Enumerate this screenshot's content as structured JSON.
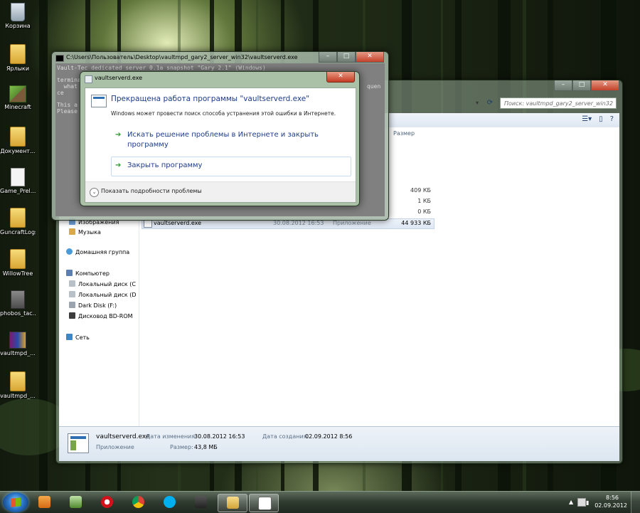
{
  "desktop": {
    "icons": [
      {
        "label": "Корзина",
        "icon": "recycle-bin-icon"
      },
      {
        "label": "Ярлыки",
        "icon": "folder-icon"
      },
      {
        "label": "Minecraft",
        "icon": "minecraft-icon"
      },
      {
        "label": "Документ...",
        "icon": "folder-icon"
      },
      {
        "label": "Game_Prel...",
        "icon": "document-icon"
      },
      {
        "label": "GuncraftLogs",
        "icon": "folder-icon"
      },
      {
        "label": "WillowTree",
        "icon": "folder-icon"
      },
      {
        "label": "phobos_tac...",
        "icon": "document-icon"
      },
      {
        "label": "vaultmpd_...",
        "icon": "winrar-archive-icon"
      },
      {
        "label": "vaultmpd_...",
        "icon": "folder-icon"
      }
    ]
  },
  "explorer": {
    "search_placeholder": "Поиск: vaultmpd_gary2_server_win32",
    "column_size_header": "Размер",
    "sizes": [
      "409 КБ",
      "1 КБ",
      "0 КБ",
      "44 933 КБ"
    ],
    "nav": {
      "images": "Изображения",
      "music": "Музыка",
      "homegroup": "Домашняя группа",
      "computer": "Компьютер",
      "local_c": "Локальный диск (C",
      "local_d": "Локальный диск (D",
      "dark_disk": "Dark Disk (F:)",
      "bdrom": "Дисковод BD-ROM",
      "network": "Сеть"
    },
    "selected_file": {
      "name": "vaultserverd.exe",
      "date": "30.08.2012 16:53",
      "type": "Приложение",
      "size": "44 933 КБ"
    },
    "details": {
      "name": "vaultserverd.exe",
      "type": "Приложение",
      "modified_label": "Дата изменения:",
      "modified_value": "30.08.2012 16:53",
      "created_label": "Дата создания:",
      "created_value": "02.09.2012 8:56",
      "size_label": "Размер:",
      "size_value": "43,8 МБ"
    }
  },
  "console": {
    "title": "C:\\Users\\Пользователь\\Desktop\\vaultmpd_gary2_server_win32\\vaultserverd.exe",
    "lines": [
      "Vault-Tec dedicated server 0.1a snapshot \"Gary 2.1\" (Windows)",
      "termina",
      "  what",
      "ce",
      "This a",
      "Please"
    ],
    "right_fragment": "quen"
  },
  "dialog": {
    "title": "vaultserverd.exe",
    "heading": "Прекращена работа программы \"vaultserverd.exe\"",
    "subtext": "Windows может провести поиск способа устранения этой ошибки в Интернете.",
    "option_search": "Искать решение проблемы в Интернете и закрыть программу",
    "option_close": "Закрыть программу",
    "show_details": "Показать подробности проблемы",
    "close_glyph": "✕"
  },
  "taskbar": {
    "time": "8:56",
    "date": "02.09.2012"
  }
}
